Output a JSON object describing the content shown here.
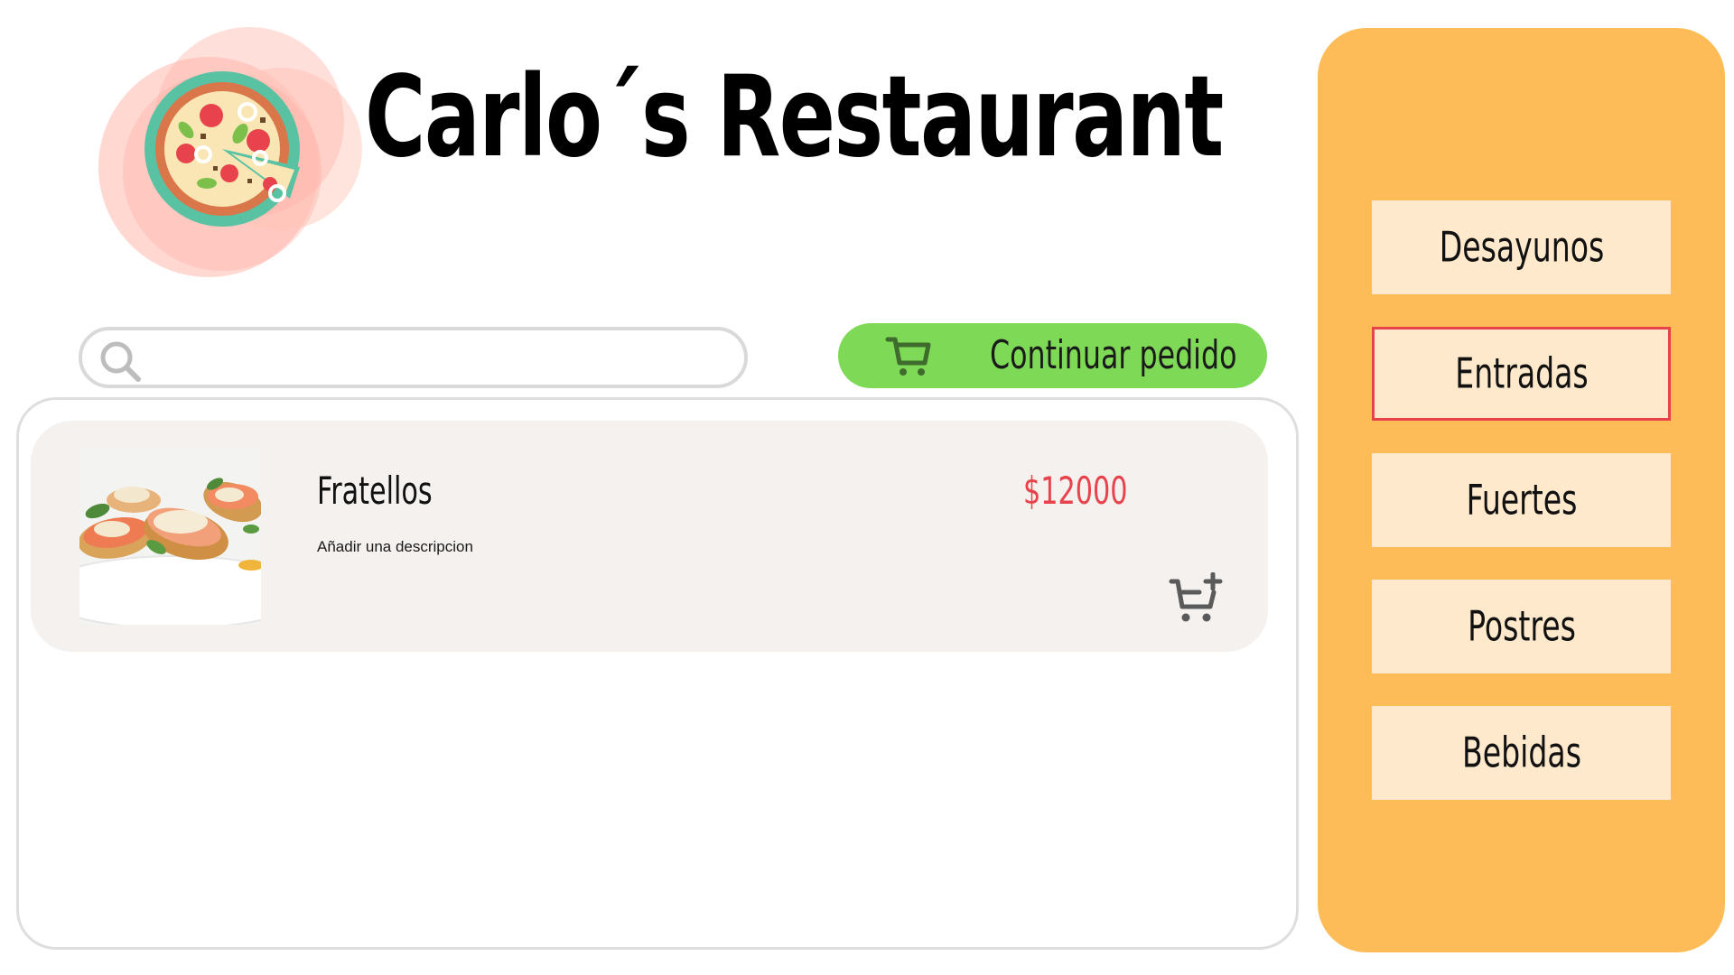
{
  "brand": {
    "title": "Carlo´s Restaurant",
    "logo_icon": "pizza-icon"
  },
  "search": {
    "placeholder": "",
    "value": "",
    "icon": "search-icon"
  },
  "actions": {
    "continue_order_label": "Continuar pedido",
    "continue_icon": "cart-icon",
    "continue_color": "#7ed957"
  },
  "products": [
    {
      "name": "Fratellos",
      "description": "Añadir una descripcion",
      "price": "$12000",
      "add_icon": "cart-plus-icon"
    }
  ],
  "categories": [
    {
      "label": "Desayunos",
      "active": false
    },
    {
      "label": "Entradas",
      "active": true
    },
    {
      "label": "Fuertes",
      "active": false
    },
    {
      "label": "Postres",
      "active": false
    },
    {
      "label": "Bebidas",
      "active": false
    }
  ],
  "colors": {
    "sidebar": "#fdbc58",
    "category_button": "#ffe9cc",
    "active_border": "#e8434d",
    "price": "#e8434d",
    "card": "#f4f1ef"
  }
}
